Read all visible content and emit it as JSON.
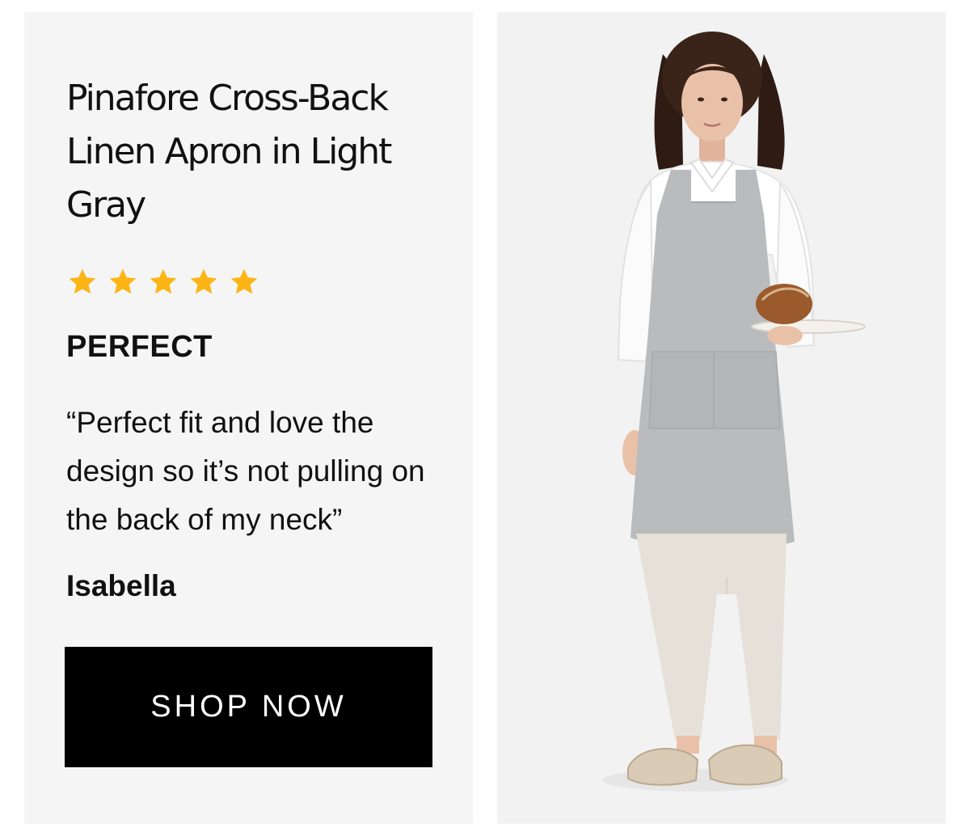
{
  "review": {
    "product_title": "Pinafore Cross-Back Linen Apron in Light Gray",
    "rating": 5,
    "rating_max": 5,
    "star_color": "#FDB515",
    "heading": "PERFECT",
    "quote": "“Perfect fit and love the design so it’s not pulling on the back of my neck”",
    "reviewer": "Isabella"
  },
  "cta": {
    "label": "SHOP NOW",
    "background": "#000000",
    "text_color": "#ffffff"
  },
  "colors": {
    "review_panel_bg": "#f5f5f5",
    "photo_panel_bg": "#f2f2f2",
    "apron": "#b9bbbc"
  }
}
